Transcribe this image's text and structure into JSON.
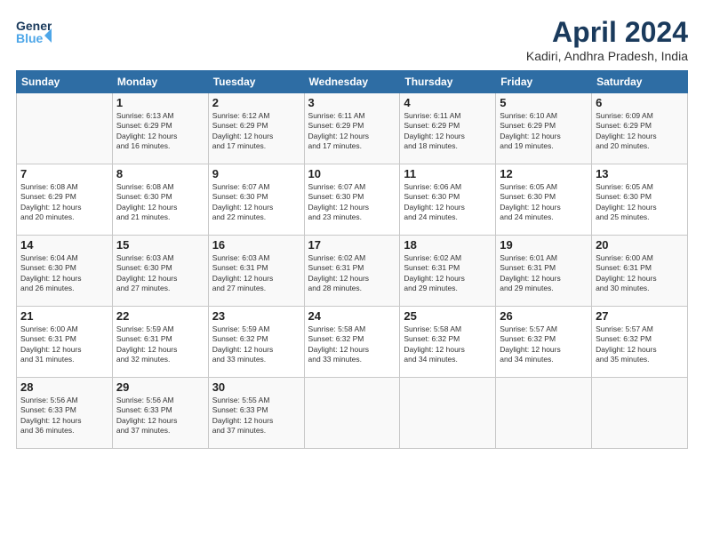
{
  "logo": {
    "line1": "General",
    "line2": "Blue"
  },
  "title": "April 2024",
  "subtitle": "Kadiri, Andhra Pradesh, India",
  "headers": [
    "Sunday",
    "Monday",
    "Tuesday",
    "Wednesday",
    "Thursday",
    "Friday",
    "Saturday"
  ],
  "weeks": [
    [
      {
        "day": "",
        "info": ""
      },
      {
        "day": "1",
        "info": "Sunrise: 6:13 AM\nSunset: 6:29 PM\nDaylight: 12 hours\nand 16 minutes."
      },
      {
        "day": "2",
        "info": "Sunrise: 6:12 AM\nSunset: 6:29 PM\nDaylight: 12 hours\nand 17 minutes."
      },
      {
        "day": "3",
        "info": "Sunrise: 6:11 AM\nSunset: 6:29 PM\nDaylight: 12 hours\nand 17 minutes."
      },
      {
        "day": "4",
        "info": "Sunrise: 6:11 AM\nSunset: 6:29 PM\nDaylight: 12 hours\nand 18 minutes."
      },
      {
        "day": "5",
        "info": "Sunrise: 6:10 AM\nSunset: 6:29 PM\nDaylight: 12 hours\nand 19 minutes."
      },
      {
        "day": "6",
        "info": "Sunrise: 6:09 AM\nSunset: 6:29 PM\nDaylight: 12 hours\nand 20 minutes."
      }
    ],
    [
      {
        "day": "7",
        "info": "Sunrise: 6:08 AM\nSunset: 6:29 PM\nDaylight: 12 hours\nand 20 minutes."
      },
      {
        "day": "8",
        "info": "Sunrise: 6:08 AM\nSunset: 6:30 PM\nDaylight: 12 hours\nand 21 minutes."
      },
      {
        "day": "9",
        "info": "Sunrise: 6:07 AM\nSunset: 6:30 PM\nDaylight: 12 hours\nand 22 minutes."
      },
      {
        "day": "10",
        "info": "Sunrise: 6:07 AM\nSunset: 6:30 PM\nDaylight: 12 hours\nand 23 minutes."
      },
      {
        "day": "11",
        "info": "Sunrise: 6:06 AM\nSunset: 6:30 PM\nDaylight: 12 hours\nand 24 minutes."
      },
      {
        "day": "12",
        "info": "Sunrise: 6:05 AM\nSunset: 6:30 PM\nDaylight: 12 hours\nand 24 minutes."
      },
      {
        "day": "13",
        "info": "Sunrise: 6:05 AM\nSunset: 6:30 PM\nDaylight: 12 hours\nand 25 minutes."
      }
    ],
    [
      {
        "day": "14",
        "info": "Sunrise: 6:04 AM\nSunset: 6:30 PM\nDaylight: 12 hours\nand 26 minutes."
      },
      {
        "day": "15",
        "info": "Sunrise: 6:03 AM\nSunset: 6:30 PM\nDaylight: 12 hours\nand 27 minutes."
      },
      {
        "day": "16",
        "info": "Sunrise: 6:03 AM\nSunset: 6:31 PM\nDaylight: 12 hours\nand 27 minutes."
      },
      {
        "day": "17",
        "info": "Sunrise: 6:02 AM\nSunset: 6:31 PM\nDaylight: 12 hours\nand 28 minutes."
      },
      {
        "day": "18",
        "info": "Sunrise: 6:02 AM\nSunset: 6:31 PM\nDaylight: 12 hours\nand 29 minutes."
      },
      {
        "day": "19",
        "info": "Sunrise: 6:01 AM\nSunset: 6:31 PM\nDaylight: 12 hours\nand 29 minutes."
      },
      {
        "day": "20",
        "info": "Sunrise: 6:00 AM\nSunset: 6:31 PM\nDaylight: 12 hours\nand 30 minutes."
      }
    ],
    [
      {
        "day": "21",
        "info": "Sunrise: 6:00 AM\nSunset: 6:31 PM\nDaylight: 12 hours\nand 31 minutes."
      },
      {
        "day": "22",
        "info": "Sunrise: 5:59 AM\nSunset: 6:31 PM\nDaylight: 12 hours\nand 32 minutes."
      },
      {
        "day": "23",
        "info": "Sunrise: 5:59 AM\nSunset: 6:32 PM\nDaylight: 12 hours\nand 33 minutes."
      },
      {
        "day": "24",
        "info": "Sunrise: 5:58 AM\nSunset: 6:32 PM\nDaylight: 12 hours\nand 33 minutes."
      },
      {
        "day": "25",
        "info": "Sunrise: 5:58 AM\nSunset: 6:32 PM\nDaylight: 12 hours\nand 34 minutes."
      },
      {
        "day": "26",
        "info": "Sunrise: 5:57 AM\nSunset: 6:32 PM\nDaylight: 12 hours\nand 34 minutes."
      },
      {
        "day": "27",
        "info": "Sunrise: 5:57 AM\nSunset: 6:32 PM\nDaylight: 12 hours\nand 35 minutes."
      }
    ],
    [
      {
        "day": "28",
        "info": "Sunrise: 5:56 AM\nSunset: 6:33 PM\nDaylight: 12 hours\nand 36 minutes."
      },
      {
        "day": "29",
        "info": "Sunrise: 5:56 AM\nSunset: 6:33 PM\nDaylight: 12 hours\nand 37 minutes."
      },
      {
        "day": "30",
        "info": "Sunrise: 5:55 AM\nSunset: 6:33 PM\nDaylight: 12 hours\nand 37 minutes."
      },
      {
        "day": "",
        "info": ""
      },
      {
        "day": "",
        "info": ""
      },
      {
        "day": "",
        "info": ""
      },
      {
        "day": "",
        "info": ""
      }
    ]
  ]
}
